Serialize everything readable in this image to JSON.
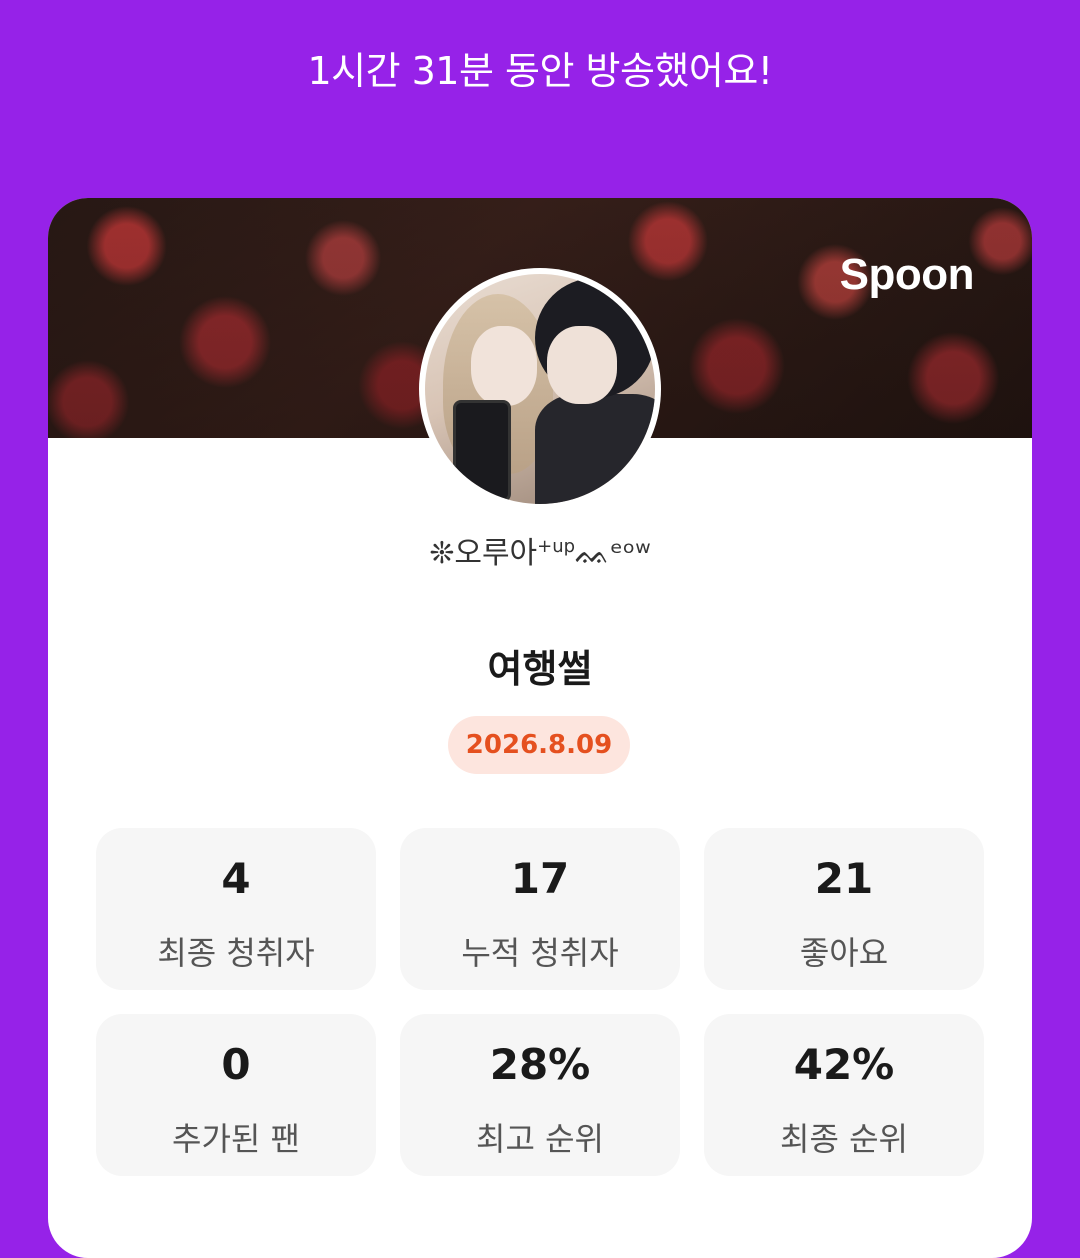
{
  "header": {
    "broadcast_duration": "1시간 31분 동안 방송했어요!"
  },
  "card": {
    "logo": "Spoon",
    "user_name": "❊오루아",
    "user_name_suffix": "+up",
    "user_name_tail": "ᨐᵉᵒʷ",
    "title": "여행썰",
    "date": "2026.8.09"
  },
  "stats": [
    {
      "value": "4",
      "label": "최종 청취자"
    },
    {
      "value": "17",
      "label": "누적 청취자"
    },
    {
      "value": "21",
      "label": "좋아요"
    },
    {
      "value": "0",
      "label": "추가된 팬"
    },
    {
      "value": "28%",
      "label": "최고 순위"
    },
    {
      "value": "42%",
      "label": "최종 순위"
    }
  ],
  "colors": {
    "background": "#9622E8",
    "date_text": "#E5501F",
    "date_pill": "#FDE5DE"
  }
}
